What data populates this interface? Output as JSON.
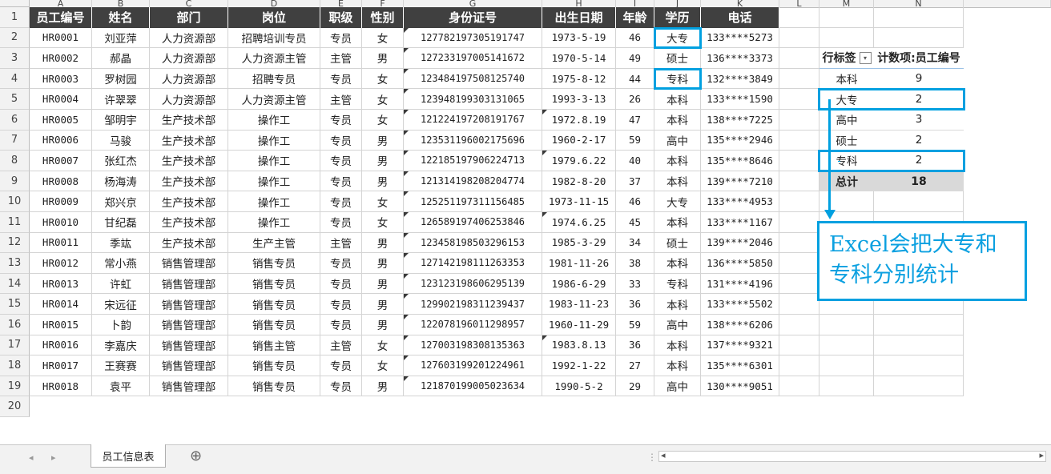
{
  "sheet": {
    "columns": [
      "A",
      "B",
      "C",
      "D",
      "E",
      "F",
      "G",
      "H",
      "I",
      "J",
      "K",
      "L",
      "M",
      "N"
    ],
    "rows": [
      "1",
      "2",
      "3",
      "4",
      "5",
      "6",
      "7",
      "8",
      "9",
      "10",
      "11",
      "12",
      "13",
      "14",
      "15",
      "16",
      "17",
      "18",
      "19",
      "20"
    ]
  },
  "table": {
    "headers": [
      "员工编号",
      "姓名",
      "部门",
      "岗位",
      "职级",
      "性别",
      "身份证号",
      "出生日期",
      "年龄",
      "学历",
      "电话"
    ],
    "rows": [
      [
        "HR0001",
        "刘亚萍",
        "人力资源部",
        "招聘培训专员",
        "专员",
        "女",
        "127782197305191747",
        "1973-5-19",
        "46",
        "大专",
        "133****5273"
      ],
      [
        "HR0002",
        "郝晶",
        "人力资源部",
        "人力资源主管",
        "主管",
        "男",
        "127233197005141672",
        "1970-5-14",
        "49",
        "硕士",
        "136****3373"
      ],
      [
        "HR0003",
        "罗树园",
        "人力资源部",
        "招聘专员",
        "专员",
        "女",
        "123484197508125740",
        "1975-8-12",
        "44",
        "专科",
        "132****3849"
      ],
      [
        "HR0004",
        "许翠翠",
        "人力资源部",
        "人力资源主管",
        "主管",
        "女",
        "123948199303131065",
        "1993-3-13",
        "26",
        "本科",
        "133****1590"
      ],
      [
        "HR0005",
        "邹明宇",
        "生产技术部",
        "操作工",
        "专员",
        "女",
        "121224197208191767",
        "1972.8.19",
        "47",
        "本科",
        "138****7225"
      ],
      [
        "HR0006",
        "马骏",
        "生产技术部",
        "操作工",
        "专员",
        "男",
        "123531196002175696",
        "1960-2-17",
        "59",
        "高中",
        "135****2946"
      ],
      [
        "HR0007",
        "张红杰",
        "生产技术部",
        "操作工",
        "专员",
        "男",
        "122185197906224713",
        "1979.6.22",
        "40",
        "本科",
        "135****8646"
      ],
      [
        "HR0008",
        "杨海涛",
        "生产技术部",
        "操作工",
        "专员",
        "男",
        "121314198208204774",
        "1982-8-20",
        "37",
        "本科",
        "139****7210"
      ],
      [
        "HR0009",
        "郑兴京",
        "生产技术部",
        "操作工",
        "专员",
        "女",
        "125251197311156485",
        "1973-11-15",
        "46",
        "大专",
        "133****4953"
      ],
      [
        "HR0010",
        "甘纪磊",
        "生产技术部",
        "操作工",
        "专员",
        "女",
        "126589197406253846",
        "1974.6.25",
        "45",
        "本科",
        "133****1167"
      ],
      [
        "HR0011",
        "季竑",
        "生产技术部",
        "生产主管",
        "主管",
        "男",
        "123458198503296153",
        "1985-3-29",
        "34",
        "硕士",
        "139****2046"
      ],
      [
        "HR0012",
        "常小燕",
        "销售管理部",
        "销售专员",
        "专员",
        "男",
        "127142198111263353",
        "1981-11-26",
        "38",
        "本科",
        "136****5850"
      ],
      [
        "HR0013",
        "许虹",
        "销售管理部",
        "销售专员",
        "专员",
        "男",
        "123123198606295139",
        "1986-6-29",
        "33",
        "专科",
        "131****4196"
      ],
      [
        "HR0014",
        "宋远征",
        "销售管理部",
        "销售专员",
        "专员",
        "男",
        "129902198311239437",
        "1983-11-23",
        "36",
        "本科",
        "133****5502"
      ],
      [
        "HR0015",
        "卜韵",
        "销售管理部",
        "销售专员",
        "专员",
        "男",
        "122078196011298957",
        "1960-11-29",
        "59",
        "高中",
        "138****6206"
      ],
      [
        "HR0016",
        "李嘉庆",
        "销售管理部",
        "销售主管",
        "主管",
        "女",
        "127003198308135363",
        "1983.8.13",
        "36",
        "本科",
        "137****9321"
      ],
      [
        "HR0017",
        "王赛赛",
        "销售管理部",
        "销售专员",
        "专员",
        "女",
        "127603199201224961",
        "1992-1-22",
        "27",
        "本科",
        "135****6301"
      ],
      [
        "HR0018",
        "袁平",
        "销售管理部",
        "销售专员",
        "专员",
        "男",
        "121870199005023634",
        "1990-5-2",
        "29",
        "高中",
        "130****9051"
      ]
    ]
  },
  "pivot": {
    "row_label": "行标签",
    "value_label": "计数项:员工编号",
    "rows": [
      {
        "label": "本科",
        "value": "9"
      },
      {
        "label": "大专",
        "value": "2"
      },
      {
        "label": "高中",
        "value": "3"
      },
      {
        "label": "硕士",
        "value": "2"
      },
      {
        "label": "专科",
        "value": "2"
      }
    ],
    "total_label": "总计",
    "total_value": "18"
  },
  "annotation": "Excel会把大专和专科分别统计",
  "tabs": {
    "active": "员工信息表",
    "add": "⊕"
  },
  "colors": {
    "header_bg": "#404040",
    "highlight": "#00a0e0",
    "excel_green": "#217346"
  }
}
